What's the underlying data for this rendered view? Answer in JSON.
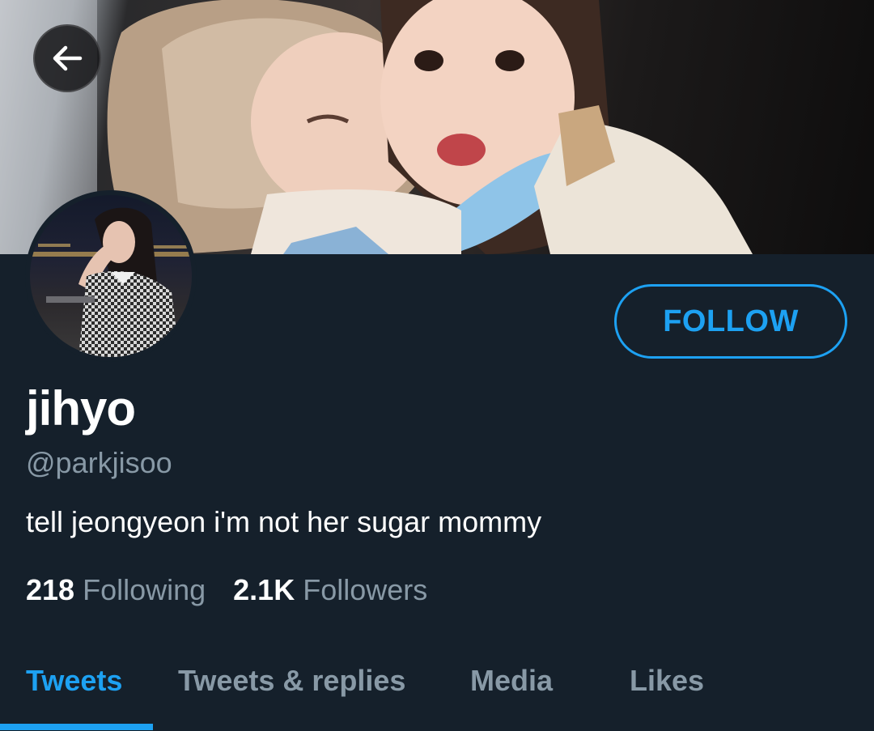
{
  "header": {
    "back_icon": "arrow-left-icon"
  },
  "profile": {
    "display_name": "jihyo",
    "handle": "@parkjisoo",
    "bio": "tell jeongyeon i'm not her sugar mommy",
    "follow_label": "FOLLOW"
  },
  "stats": {
    "following_count": "218",
    "following_label": "Following",
    "followers_count": "2.1K",
    "followers_label": "Followers"
  },
  "tabs": [
    {
      "label": "Tweets",
      "active": true
    },
    {
      "label": "Tweets & replies",
      "active": false
    },
    {
      "label": "Media",
      "active": false
    },
    {
      "label": "Likes",
      "active": false
    }
  ],
  "colors": {
    "background": "#15202b",
    "accent": "#1da1f2",
    "secondary_text": "#8899a6"
  }
}
